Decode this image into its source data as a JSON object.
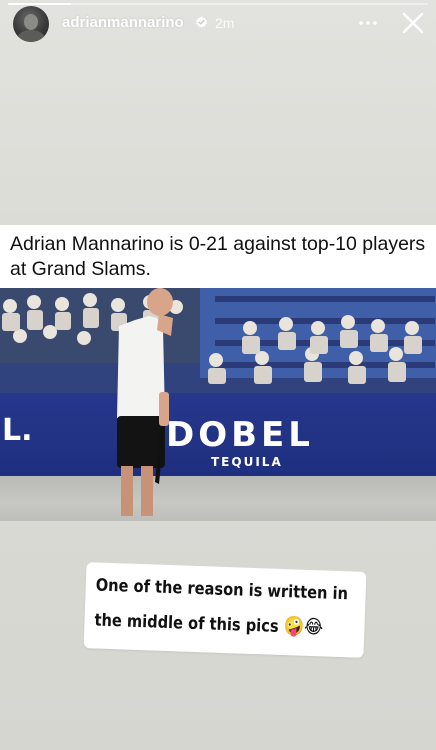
{
  "story": {
    "progress_fraction": 0.15
  },
  "header": {
    "username": "adrianmannarino",
    "timestamp": "2m",
    "verified_icon": "verified-badge-icon",
    "more_icon": "more-dots-icon",
    "close_icon": "close-icon"
  },
  "post": {
    "headline": "Adrian Mannarino is 0-21 against top-10 players at Grand Slams.",
    "photo": {
      "banner_left": "L.",
      "banner_brand": "DOBEL",
      "banner_sub": "TEQUILA"
    }
  },
  "sticker": {
    "line1": "One of the reason is written in",
    "line2": "the middle of this pics",
    "emojis": "🤪😂"
  },
  "colors": {
    "background": "#dcdcd7",
    "ad_board": "#26378c",
    "court": "#c7c8c4"
  }
}
